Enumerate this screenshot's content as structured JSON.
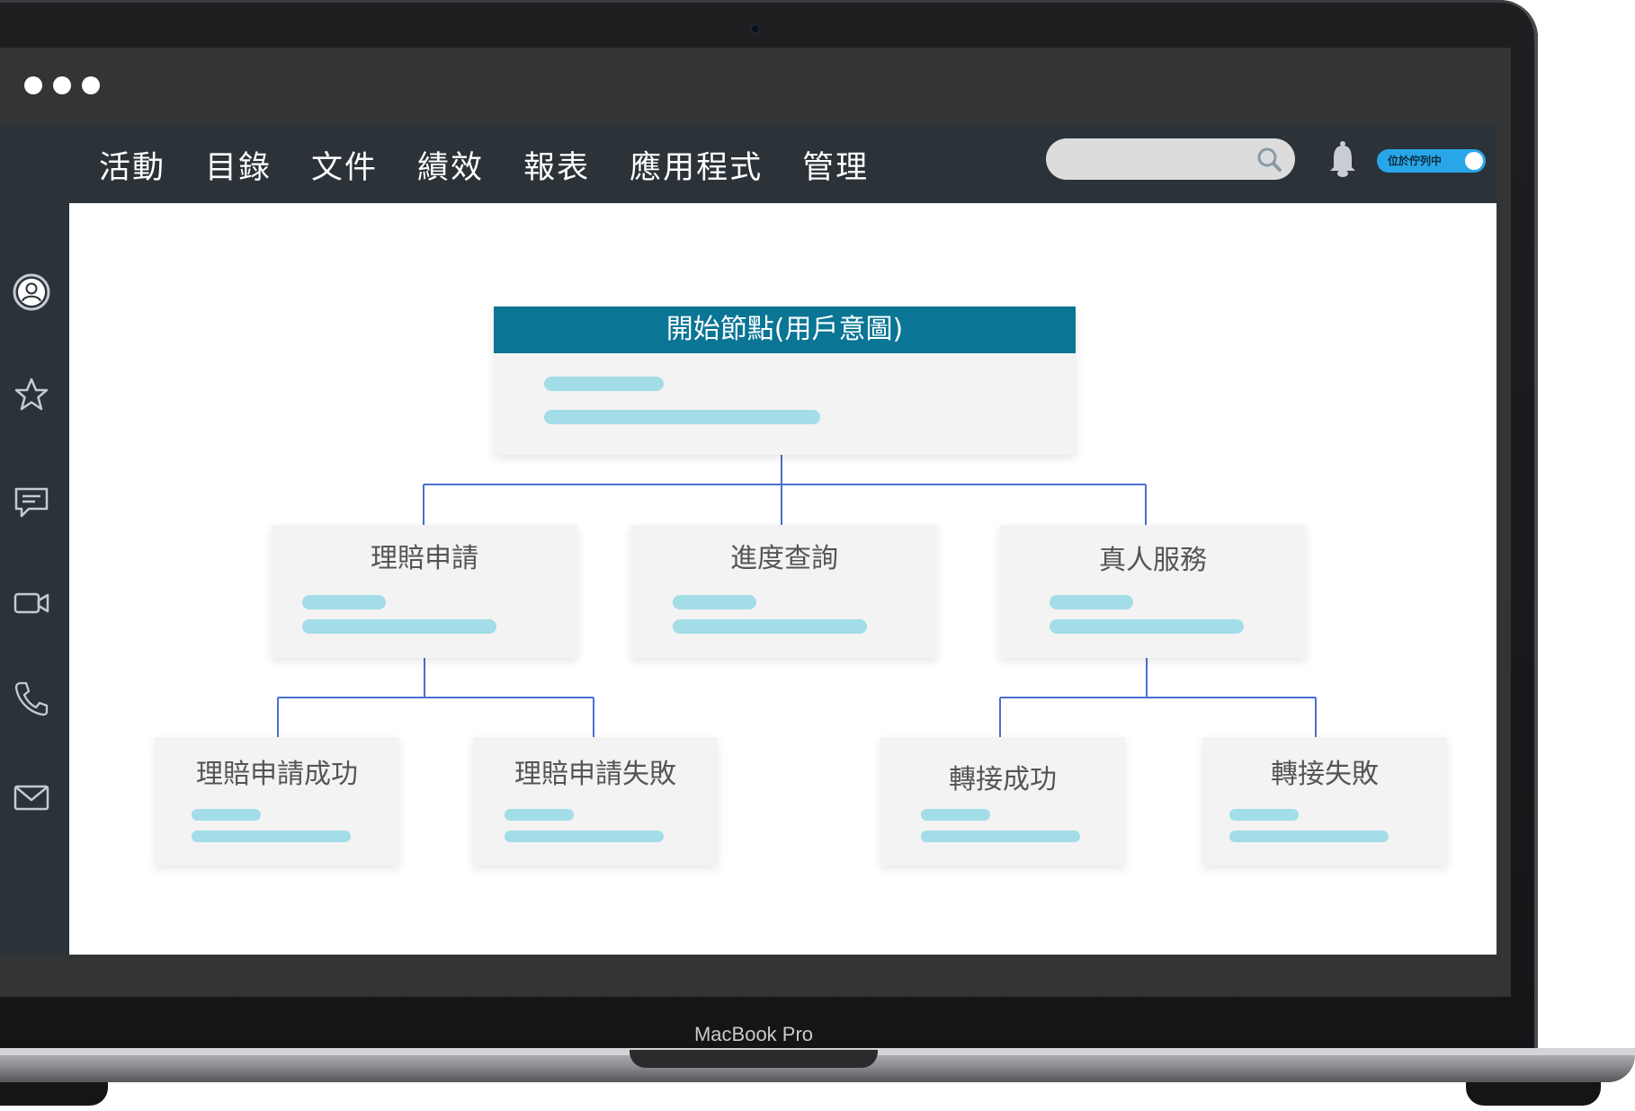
{
  "device": {
    "brand_label": "MacBook Pro"
  },
  "nav": {
    "items": [
      {
        "label": "活動"
      },
      {
        "label": "目錄"
      },
      {
        "label": "文件"
      },
      {
        "label": "績效"
      },
      {
        "label": "報表"
      },
      {
        "label": "應用程式"
      },
      {
        "label": "管理"
      }
    ]
  },
  "search": {
    "placeholder": ""
  },
  "status_toggle": {
    "label": "位於佇列中",
    "on": true,
    "color": "#29a6e8"
  },
  "sidebar": {
    "items": [
      {
        "icon": "user-icon"
      },
      {
        "icon": "star-icon"
      },
      {
        "icon": "chat-icon"
      },
      {
        "icon": "video-icon"
      },
      {
        "icon": "phone-icon"
      },
      {
        "icon": "mail-icon"
      }
    ]
  },
  "flow": {
    "root": {
      "title": "開始節點(用戶意圖)",
      "color": "#0a7594"
    },
    "level1": [
      {
        "title": "理賠申請"
      },
      {
        "title": "進度查詢"
      },
      {
        "title": "真人服務"
      }
    ],
    "level2": [
      {
        "title": "理賠申請成功"
      },
      {
        "title": "理賠申請失敗"
      },
      {
        "title": "轉接成功"
      },
      {
        "title": "轉接失敗"
      }
    ],
    "placeholder_bar_color": "#a2dde8",
    "connector_color": "#4a6fd1"
  }
}
